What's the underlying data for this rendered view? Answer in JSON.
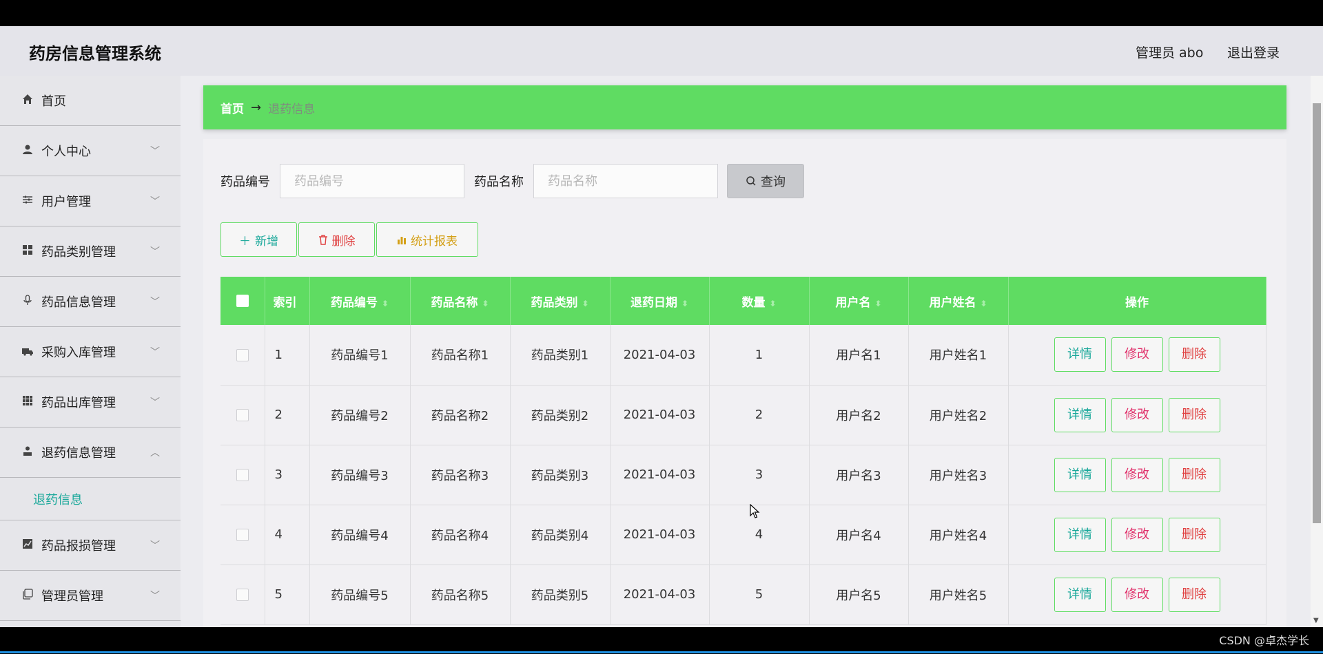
{
  "app": {
    "title": "药房信息管理系统",
    "user_label": "管理员 abo",
    "logout_label": "退出登录"
  },
  "sidebar": {
    "items": [
      {
        "label": "首页",
        "icon": "home-icon",
        "has_chevron": false
      },
      {
        "label": "个人中心",
        "icon": "user-icon",
        "has_chevron": true
      },
      {
        "label": "用户管理",
        "icon": "sliders-icon",
        "has_chevron": true
      },
      {
        "label": "药品类别管理",
        "icon": "grid-icon",
        "has_chevron": true
      },
      {
        "label": "药品信息管理",
        "icon": "microphone-icon",
        "has_chevron": true
      },
      {
        "label": "采购入库管理",
        "icon": "truck-icon",
        "has_chevron": true
      },
      {
        "label": "药品出库管理",
        "icon": "apps-icon",
        "has_chevron": true
      },
      {
        "label": "退药信息管理",
        "icon": "person-icon",
        "has_chevron": true,
        "expanded": true
      },
      {
        "label": "药品报损管理",
        "icon": "chart-icon",
        "has_chevron": true
      },
      {
        "label": "管理员管理",
        "icon": "copy-icon",
        "has_chevron": true
      }
    ],
    "submenu": {
      "label": "退药信息"
    }
  },
  "breadcrumb": {
    "home": "首页",
    "arrow": "→",
    "current": "退药信息"
  },
  "search": {
    "code_label": "药品编号",
    "code_placeholder": "药品编号",
    "name_label": "药品名称",
    "name_placeholder": "药品名称",
    "button_label": "查询"
  },
  "actions": {
    "add": "新增",
    "delete": "删除",
    "report": "统计报表"
  },
  "table": {
    "headers": [
      "索引",
      "药品编号",
      "药品名称",
      "药品类别",
      "退药日期",
      "数量",
      "用户名",
      "用户姓名",
      "操作"
    ],
    "rows": [
      {
        "index": "1",
        "code": "药品编号1",
        "name": "药品名称1",
        "category": "药品类别1",
        "date": "2021-04-03",
        "qty": "1",
        "username": "用户名1",
        "realname": "用户姓名1"
      },
      {
        "index": "2",
        "code": "药品编号2",
        "name": "药品名称2",
        "category": "药品类别2",
        "date": "2021-04-03",
        "qty": "2",
        "username": "用户名2",
        "realname": "用户姓名2"
      },
      {
        "index": "3",
        "code": "药品编号3",
        "name": "药品名称3",
        "category": "药品类别3",
        "date": "2021-04-03",
        "qty": "3",
        "username": "用户名3",
        "realname": "用户姓名3"
      },
      {
        "index": "4",
        "code": "药品编号4",
        "name": "药品名称4",
        "category": "药品类别4",
        "date": "2021-04-03",
        "qty": "4",
        "username": "用户名4",
        "realname": "用户姓名4"
      },
      {
        "index": "5",
        "code": "药品编号5",
        "name": "药品名称5",
        "category": "药品类别5",
        "date": "2021-04-03",
        "qty": "5",
        "username": "用户名5",
        "realname": "用户姓名5"
      }
    ],
    "op_detail": "详情",
    "op_edit": "修改",
    "op_delete": "删除"
  },
  "watermark": "CSDN @卓杰学长",
  "colors": {
    "accent": "#5fdc62",
    "teal": "#1aa89a",
    "danger": "#e04040",
    "pink": "#e0306a",
    "gold": "#d4a017"
  }
}
